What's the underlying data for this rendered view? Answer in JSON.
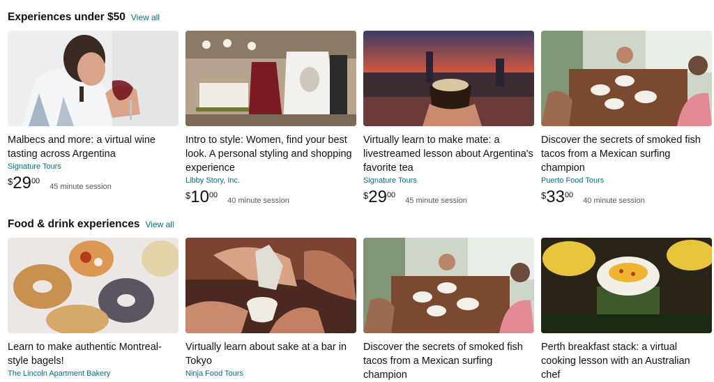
{
  "sections": [
    {
      "title": "Experiences under $50",
      "view_all": "View all",
      "cards": [
        {
          "title": "Malbecs and more: a virtual wine tasting across Argentina",
          "vendor": "Signature Tours",
          "price_symbol": "$",
          "price_whole": "29",
          "price_fraction": "00",
          "duration": "45 minute session"
        },
        {
          "title": "Intro to style: Women, find your best look. A personal styling and shopping experience",
          "vendor": "Libby Story, Inc.",
          "price_symbol": "$",
          "price_whole": "10",
          "price_fraction": "00",
          "duration": "40 minute session"
        },
        {
          "title": "Virtually learn to make mate: a livestreamed lesson about Argentina's favorite tea",
          "vendor": "Signature Tours",
          "price_symbol": "$",
          "price_whole": "29",
          "price_fraction": "00",
          "duration": "45 minute session"
        },
        {
          "title": "Discover the secrets of smoked fish tacos from a Mexican surfing champion",
          "vendor": "Puerto Food Tours",
          "price_symbol": "$",
          "price_whole": "33",
          "price_fraction": "00",
          "duration": "40 minute session"
        }
      ]
    },
    {
      "title": "Food & drink experiences",
      "view_all": "View all",
      "cards": [
        {
          "title": "Learn to make authentic Montreal-style bagels!",
          "vendor": "The Lincoln Apartment Bakery"
        },
        {
          "title": "Virtually learn about sake at a bar in Tokyo",
          "vendor": "Ninja Food Tours"
        },
        {
          "title": "Discover the secrets of smoked fish tacos from a Mexican surfing champion",
          "vendor": ""
        },
        {
          "title": "Perth breakfast stack: a virtual cooking lesson with an Australian chef",
          "vendor": ""
        }
      ]
    }
  ],
  "colors": {
    "link": "#007185",
    "text": "#0f1111",
    "muted": "#565959"
  }
}
